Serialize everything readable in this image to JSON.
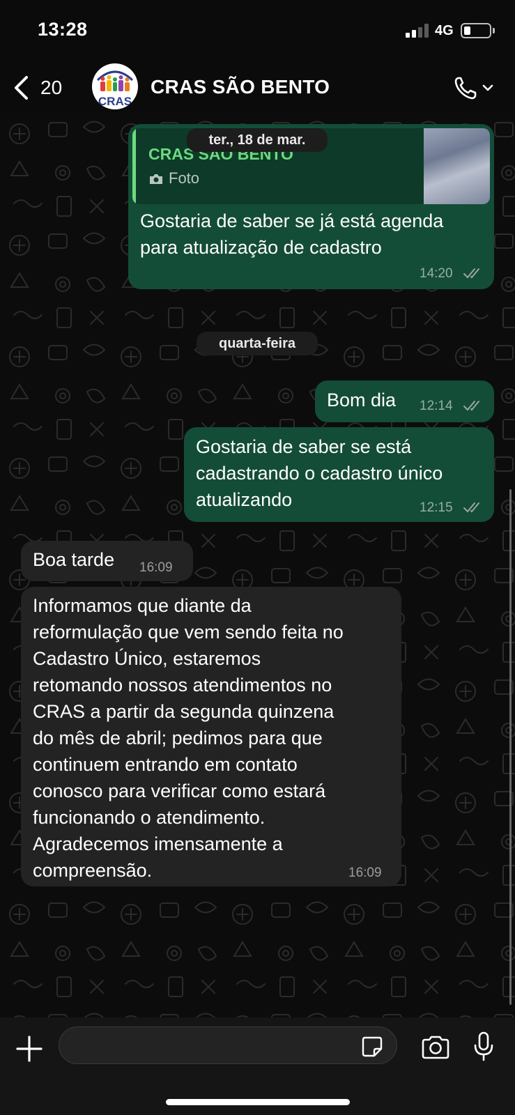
{
  "status_bar": {
    "time": "13:28",
    "network": "4G",
    "signal_bars": 2,
    "battery_level": 0.25
  },
  "header": {
    "back_count": "20",
    "contact_name": "CRAS SÃO BENTO",
    "avatar_text": "CRAS",
    "icons": [
      "chevron-left-icon",
      "phone-icon",
      "chevron-down-icon"
    ]
  },
  "messages": [
    {
      "direction": "out",
      "quote": {
        "author": "CRAS SÃO BENTO",
        "type": "Foto"
      },
      "lines": [
        "Gostaria de saber se já está agenda",
        "para atualização de cadastro"
      ],
      "time": "14:20",
      "status": "delivered"
    },
    {
      "direction": "out",
      "lines": [
        "Bom dia"
      ],
      "time": "12:14",
      "status": "delivered"
    },
    {
      "direction": "out",
      "lines": [
        "Gostaria de saber se está",
        "cadastrando o cadastro único",
        "atualizando"
      ],
      "time": "12:15",
      "status": "delivered"
    },
    {
      "direction": "in",
      "lines": [
        "Boa tarde"
      ],
      "time": "16:09"
    },
    {
      "direction": "in",
      "lines": [
        "Informamos que diante da",
        "reformulação que vem sendo feita no",
        "Cadastro Único, estaremos",
        "retomando nossos atendimentos no",
        "CRAS a partir da segunda quinzena",
        "do mês de abril; pedimos para que",
        "continuem entrando em contato",
        "conosco para verificar como estará",
        "funcionando o atendimento.",
        "Agradecemos imensamente a",
        "compreensão."
      ],
      "time": "16:09"
    }
  ],
  "date_separators": [
    "ter., 18 de mar.",
    "quarta-feira"
  ],
  "composer": {
    "value": "",
    "placeholder": "",
    "icons": [
      "plus-icon",
      "sticker-icon",
      "camera-icon",
      "microphone-icon"
    ]
  },
  "colors": {
    "outgoing_bubble": "#144d37",
    "incoming_bubble": "#232323",
    "quote_accent": "#6cdb7e",
    "background": "#0b0b0b"
  }
}
